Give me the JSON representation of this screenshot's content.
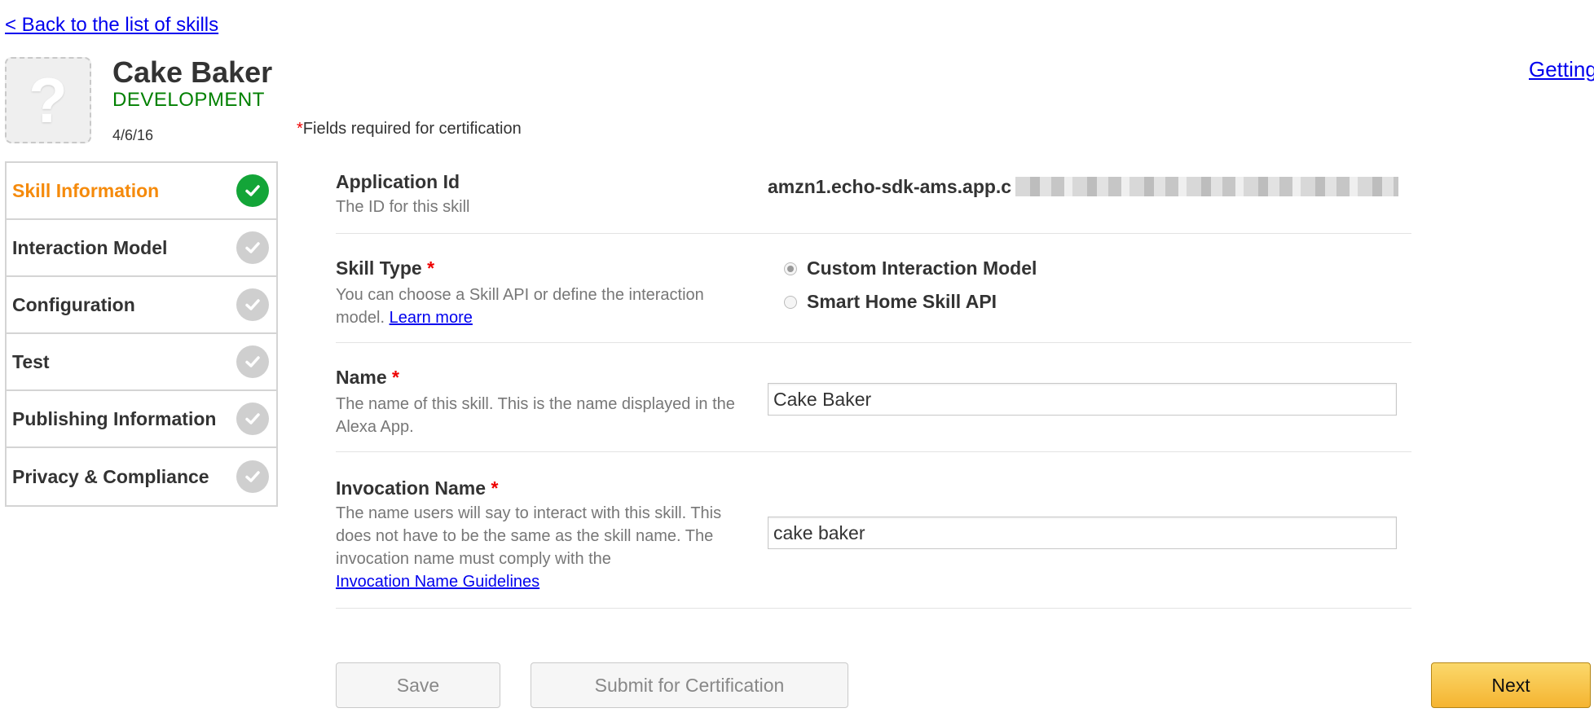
{
  "nav": {
    "back_link": "< Back to the list of skills",
    "getting_started_link": "Getting"
  },
  "skill": {
    "icon_glyph": "?",
    "name": "Cake Baker",
    "status": "DEVELOPMENT",
    "date": "4/6/16"
  },
  "required_note": {
    "star": "*",
    "text": "Fields required for certification"
  },
  "sidebar": {
    "items": [
      {
        "label": "Skill Information",
        "active": true,
        "complete": true
      },
      {
        "label": "Interaction Model",
        "active": false,
        "complete": false
      },
      {
        "label": "Configuration",
        "active": false,
        "complete": false
      },
      {
        "label": "Test",
        "active": false,
        "complete": false
      },
      {
        "label": "Publishing Information",
        "active": false,
        "complete": false
      },
      {
        "label": "Privacy & Compliance",
        "active": false,
        "complete": false
      }
    ]
  },
  "form": {
    "application_id": {
      "label": "Application Id",
      "description": "The ID for this skill",
      "value": "amzn1.echo-sdk-ams.app.c"
    },
    "skill_type": {
      "label": "Skill Type",
      "star": "*",
      "description": "You can choose a Skill API or define the interaction model.",
      "link": "Learn more",
      "options": [
        {
          "label": "Custom Interaction Model",
          "selected": true
        },
        {
          "label": "Smart Home Skill API",
          "selected": false
        }
      ]
    },
    "name": {
      "label": "Name",
      "star": "*",
      "description": "The name of this skill. This is the name displayed in the Alexa App.",
      "value": "Cake Baker"
    },
    "invocation_name": {
      "label": "Invocation Name",
      "star": "*",
      "description": "The name users will say to interact with this skill. This does not have to be the same as the skill name. The invocation name must comply with the",
      "link": "Invocation Name Guidelines",
      "value": "cake baker"
    }
  },
  "buttons": {
    "save": "Save",
    "submit": "Submit for Certification",
    "next": "Next"
  },
  "colors": {
    "active_nav": "#f58a0b",
    "status_green": "#008000",
    "check_done": "#13a538",
    "check_pending": "#cfcfcf",
    "required_star": "#e00000",
    "next_button": "#f5b431"
  }
}
